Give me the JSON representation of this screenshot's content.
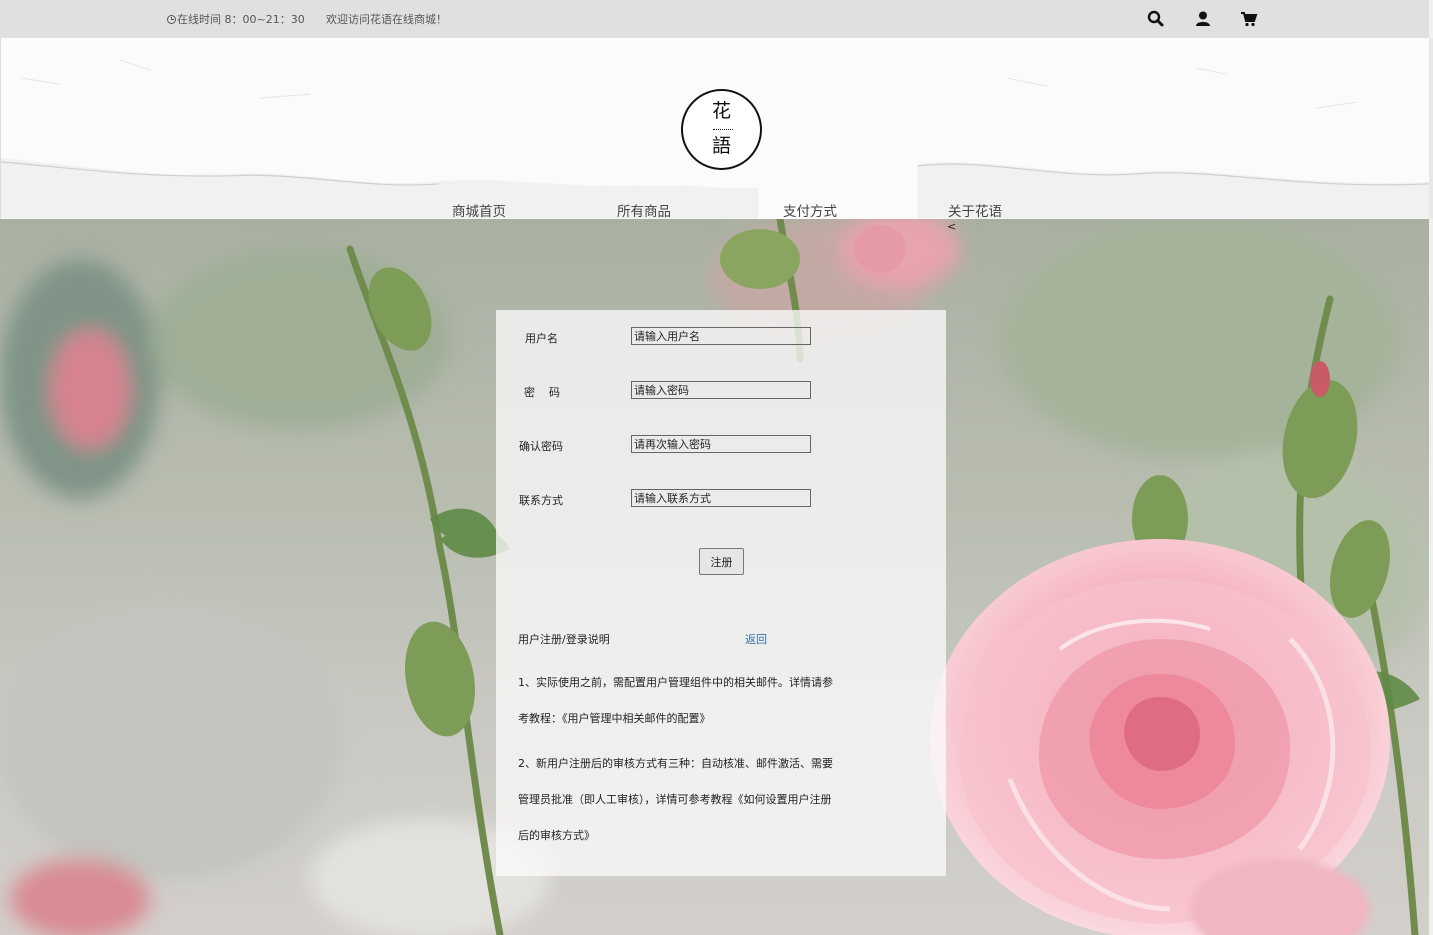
{
  "topbar": {
    "hours": "在线时间 8：00~21：30",
    "welcome": "欢迎访问花语在线商城！",
    "icons": [
      "search-icon",
      "user-icon",
      "cart-icon"
    ]
  },
  "logo": {
    "char_top": "花",
    "char_bottom": "語"
  },
  "nav": {
    "items": [
      {
        "label": "商城首页"
      },
      {
        "label": "所有商品"
      },
      {
        "label": "支付方式"
      },
      {
        "label": "关于花语"
      }
    ],
    "stray_mark": "<"
  },
  "form": {
    "username": {
      "label": "用户名",
      "placeholder": "请输入用户名",
      "value": ""
    },
    "password": {
      "label": "密    码",
      "placeholder": "请输入密码",
      "value": ""
    },
    "confirm_password": {
      "label": "确认密码",
      "placeholder": "请再次输入密码",
      "value": ""
    },
    "contact": {
      "label": "联系方式",
      "placeholder": "请输入联系方式",
      "value": ""
    },
    "submit_label": "注册"
  },
  "notes": {
    "title": "用户注册/登录说明",
    "back_label": "返回",
    "items": [
      "1、实际使用之前，需配置用户管理组件中的相关邮件。详情请参考教程：《用户管理中相关邮件的配置》",
      "2、新用户注册后的审核方式有三种：自动核准、邮件激活、需要管理员批准（即人工审核），详情可参考教程《如何设置用户注册后的审核方式》"
    ]
  },
  "colors": {
    "topbar_bg": "#e0e0e0",
    "panel_bg": "rgba(250,250,250,0.78)",
    "link": "#3a6fb0",
    "rose_pink": "#f2a7b4"
  }
}
